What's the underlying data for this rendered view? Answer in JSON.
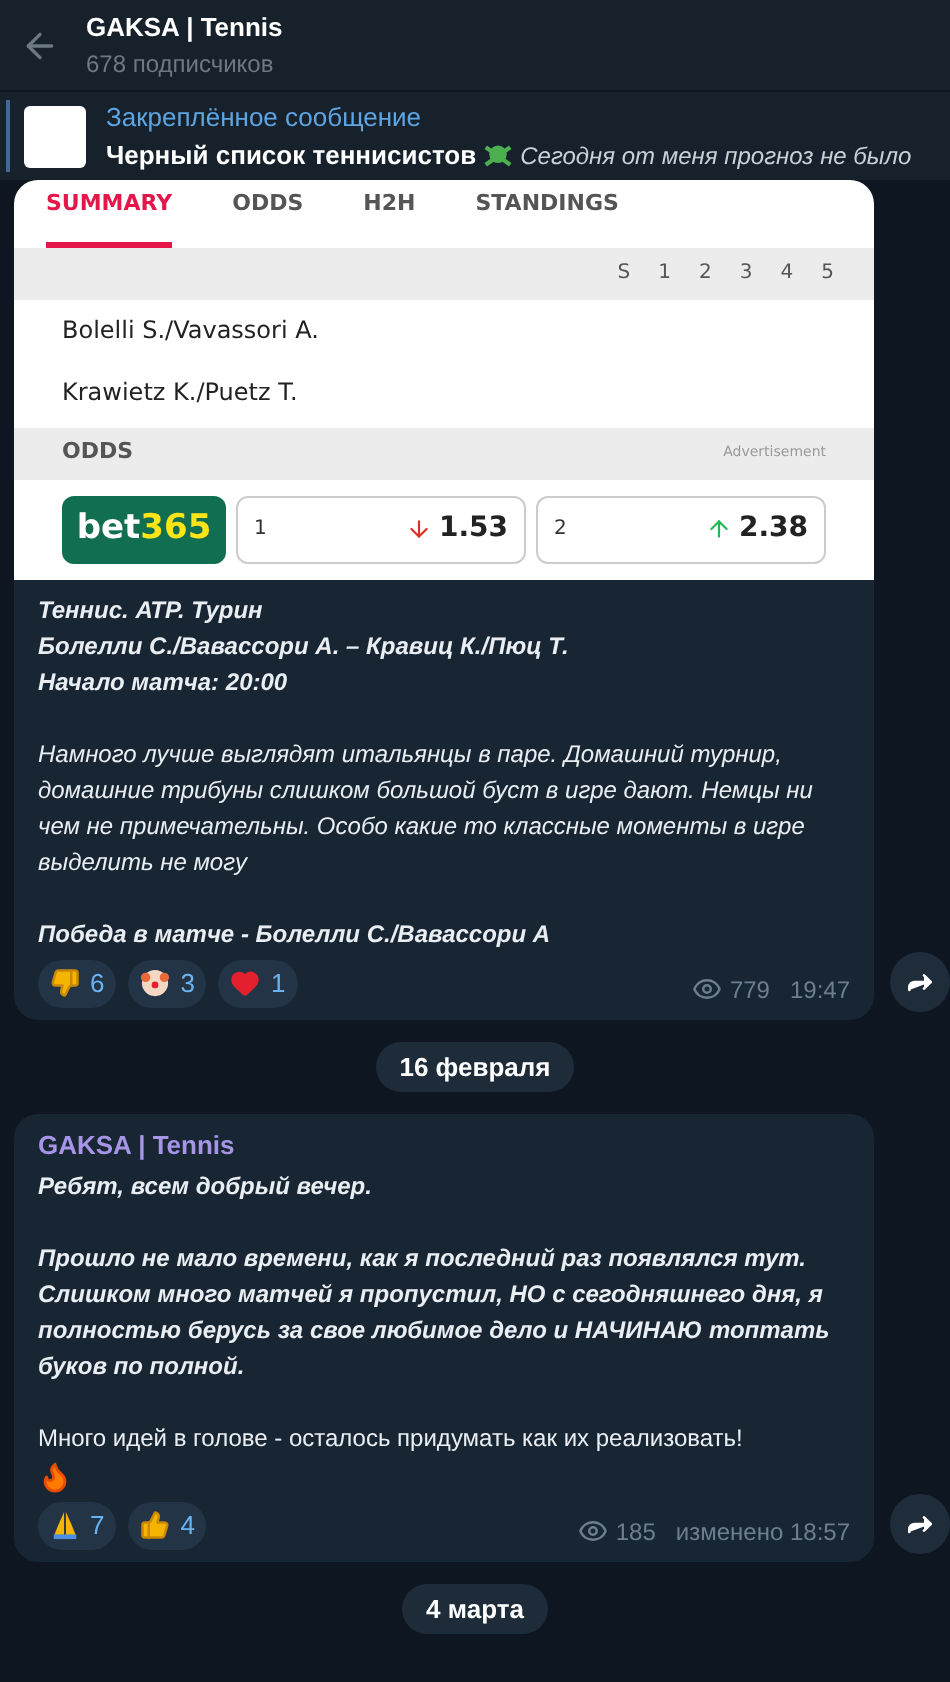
{
  "header": {
    "title": "GAKSA | Tennis",
    "subtitle": "678 подписчиков"
  },
  "pinned": {
    "label": "Закреплённое сообщение",
    "text": "Черный список теннисистов",
    "preview": "Сегодня от меня прогноз не было"
  },
  "messages": [
    {
      "kind": "post",
      "embed": {
        "tabs": [
          {
            "label": "SUMMARY",
            "selected": true
          },
          {
            "label": "ODDS",
            "selected": false
          },
          {
            "label": "H2H",
            "selected": false
          },
          {
            "label": "STANDINGS",
            "selected": false
          }
        ],
        "score_columns": [
          "S",
          "1",
          "2",
          "3",
          "4",
          "5"
        ],
        "teams": [
          "Bolelli S./Vavassori A.",
          "Krawietz K./Puetz T."
        ],
        "odds_title": "ODDS",
        "ad_label": "Advertisement",
        "bookmaker": {
          "part_1": "bet",
          "part_2": "365"
        },
        "odds": [
          {
            "label": "1",
            "kind": "falling",
            "value": "1.53"
          },
          {
            "label": "2",
            "kind": "rising",
            "value": "2.38"
          }
        ]
      },
      "paragraphs": [
        {
          "kind": "emphasis",
          "lines": [
            "Теннис. АТР. Турин",
            "Болелли С./Вавассори А. – Кравиц К./Пюц Т.",
            "Начало матча: 20:00"
          ]
        },
        {
          "kind": "comment",
          "lines": [
            "Намного лучше выглядят итальянцы в паре. Домашний турнир, домашние трибуны слишком большой буст в игре дают. Немцы ни чем не примечательны. Особо какие то классные моменты в игре выделить не могу"
          ]
        },
        {
          "kind": "emphasis",
          "lines": [
            "Победа в матче - Болелли С./Вавассори А"
          ]
        }
      ],
      "reactions": [
        {
          "kind": "thumbs_down",
          "count": "6"
        },
        {
          "kind": "clown",
          "count": "3"
        },
        {
          "kind": "heart",
          "count": "1"
        }
      ],
      "views": "779",
      "time": "19:47"
    },
    {
      "kind": "date",
      "label": "16 февраля"
    },
    {
      "kind": "post",
      "author": "GAKSA | Tennis",
      "paragraphs": [
        {
          "kind": "emphasis",
          "lines": [
            "Ребят, всем добрый вечер."
          ]
        },
        {
          "kind": "emphasis",
          "lines": [
            "Прошло не мало времени, как я последний раз появлялся тут. Слишком много матчей я пропустил, НО с сегодняшнего дня, я полностью берусь за свое любимое дело и НАЧИНАЮ топтать буков по полной."
          ]
        },
        {
          "kind": "plain",
          "lines": [
            "Много идей в голове - осталось придумать как их реализовать!"
          ]
        }
      ],
      "sticker": {
        "kind": "fire"
      },
      "reactions": [
        {
          "kind": "pray",
          "count": "7"
        },
        {
          "kind": "thumbs_up",
          "count": "4"
        }
      ],
      "views": "185",
      "time": "изменено 18:57"
    },
    {
      "kind": "date",
      "label": "4 марта"
    }
  ]
}
